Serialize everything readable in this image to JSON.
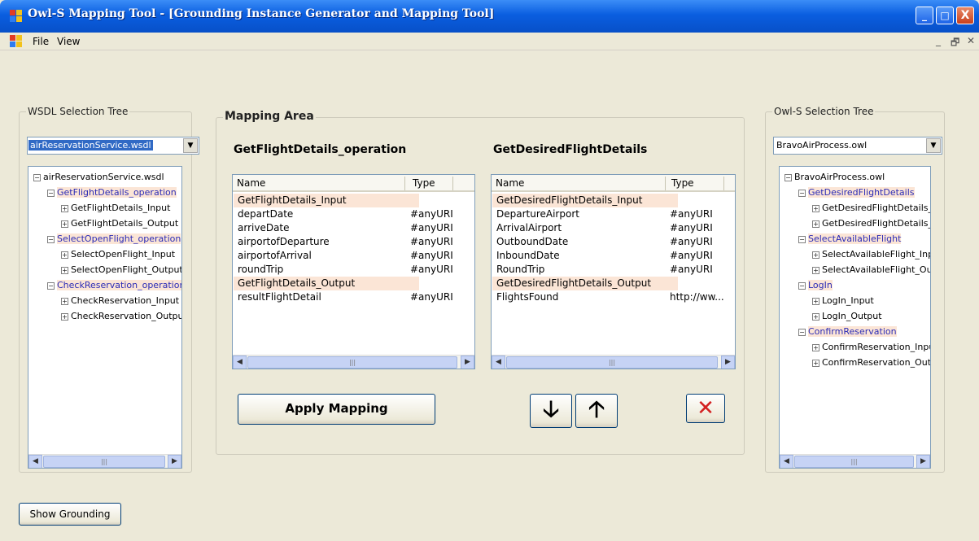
{
  "window": {
    "title": "Owl-S Mapping Tool - [Grounding Instance Generator and Mapping Tool]",
    "minimize": "_",
    "maximize": "□",
    "close": "X"
  },
  "menu": {
    "file": "File",
    "view": "View",
    "mdi_minimize": "_",
    "mdi_restore": "🗗",
    "mdi_close": "✕"
  },
  "wsdl": {
    "group_label": "WSDL Selection Tree",
    "combo_value": "airReservationService.wsdl",
    "tree": [
      {
        "label": "airReservationService.wsdl",
        "blue": false,
        "sel": false,
        "toggle": "−"
      },
      {
        "label": "GetFlightDetails_operation",
        "blue": true,
        "sel": true,
        "toggle": "−"
      },
      {
        "label": "GetFlightDetails_Input",
        "blue": false,
        "sel": false,
        "toggle": "+"
      },
      {
        "label": "GetFlightDetails_Output",
        "blue": false,
        "sel": false,
        "toggle": "+"
      },
      {
        "label": "SelectOpenFlight_operation",
        "blue": true,
        "sel": true,
        "toggle": "−"
      },
      {
        "label": "SelectOpenFlight_Input",
        "blue": false,
        "sel": false,
        "toggle": "+"
      },
      {
        "label": "SelectOpenFlight_Output",
        "blue": false,
        "sel": false,
        "toggle": "+"
      },
      {
        "label": "CheckReservation_operation",
        "blue": true,
        "sel": true,
        "toggle": "−"
      },
      {
        "label": "CheckReservation_Input",
        "blue": false,
        "sel": false,
        "toggle": "+"
      },
      {
        "label": "CheckReservation_Output",
        "blue": false,
        "sel": false,
        "toggle": "+"
      }
    ]
  },
  "owls": {
    "group_label": "Owl-S Selection Tree",
    "combo_value": "BravoAirProcess.owl",
    "tree": [
      {
        "label": "BravoAirProcess.owl",
        "blue": false,
        "sel": false,
        "toggle": "−"
      },
      {
        "label": "GetDesiredFlightDetails",
        "blue": true,
        "sel": true,
        "toggle": "−"
      },
      {
        "label": "GetDesiredFlightDetails_Input",
        "blue": false,
        "sel": false,
        "toggle": "+"
      },
      {
        "label": "GetDesiredFlightDetails_Output",
        "blue": false,
        "sel": false,
        "toggle": "+"
      },
      {
        "label": "SelectAvailableFlight",
        "blue": true,
        "sel": true,
        "toggle": "−"
      },
      {
        "label": "SelectAvailableFlight_Input",
        "blue": false,
        "sel": false,
        "toggle": "+"
      },
      {
        "label": "SelectAvailableFlight_Output",
        "blue": false,
        "sel": false,
        "toggle": "+"
      },
      {
        "label": "LogIn",
        "blue": true,
        "sel": true,
        "toggle": "−"
      },
      {
        "label": "LogIn_Input",
        "blue": false,
        "sel": false,
        "toggle": "+"
      },
      {
        "label": "LogIn_Output",
        "blue": false,
        "sel": false,
        "toggle": "+"
      },
      {
        "label": "ConfirmReservation",
        "blue": true,
        "sel": true,
        "toggle": "−"
      },
      {
        "label": "ConfirmReservation_Input",
        "blue": false,
        "sel": false,
        "toggle": "+"
      },
      {
        "label": "ConfirmReservation_Output",
        "blue": false,
        "sel": false,
        "toggle": "+"
      }
    ]
  },
  "mapping": {
    "group_label": "Mapping Area",
    "left_title": "GetFlightDetails_operation",
    "right_title": "GetDesiredFlightDetails",
    "columns": [
      "Name",
      "Type"
    ],
    "left_rows": [
      {
        "name": "GetFlightDetails_Input",
        "type": "",
        "group": true
      },
      {
        "name": "departDate",
        "type": "#anyURI",
        "group": false
      },
      {
        "name": "arriveDate",
        "type": "#anyURI",
        "group": false
      },
      {
        "name": "airportofDeparture",
        "type": "#anyURI",
        "group": false
      },
      {
        "name": "airportofArrival",
        "type": "#anyURI",
        "group": false
      },
      {
        "name": "roundTrip",
        "type": "#anyURI",
        "group": false
      },
      {
        "name": "GetFlightDetails_Output",
        "type": "",
        "group": true
      },
      {
        "name": "resultFlightDetail",
        "type": "#anyURI",
        "group": false
      }
    ],
    "right_rows": [
      {
        "name": "GetDesiredFlightDetails_Input",
        "type": "",
        "group": true
      },
      {
        "name": "DepartureAirport",
        "type": "#anyURI",
        "group": false
      },
      {
        "name": "ArrivalAirport",
        "type": "#anyURI",
        "group": false
      },
      {
        "name": "OutboundDate",
        "type": "#anyURI",
        "group": false
      },
      {
        "name": "InboundDate",
        "type": "#anyURI",
        "group": false
      },
      {
        "name": "RoundTrip",
        "type": "#anyURI",
        "group": false
      },
      {
        "name": "GetDesiredFlightDetails_Output",
        "type": "",
        "group": true
      },
      {
        "name": "FlightsFound",
        "type": "http://ww...",
        "group": false
      }
    ],
    "apply_label": "Apply Mapping",
    "down_glyph": "🡣",
    "up_glyph": "🡡",
    "remove_glyph": "✕"
  },
  "show_grounding_label": "Show Grounding",
  "colors": {
    "title_blue": "#0a5ee0",
    "node_blue": "#2b2bb6",
    "highlight": "#fbe5d6",
    "remove_red": "#d32020"
  }
}
